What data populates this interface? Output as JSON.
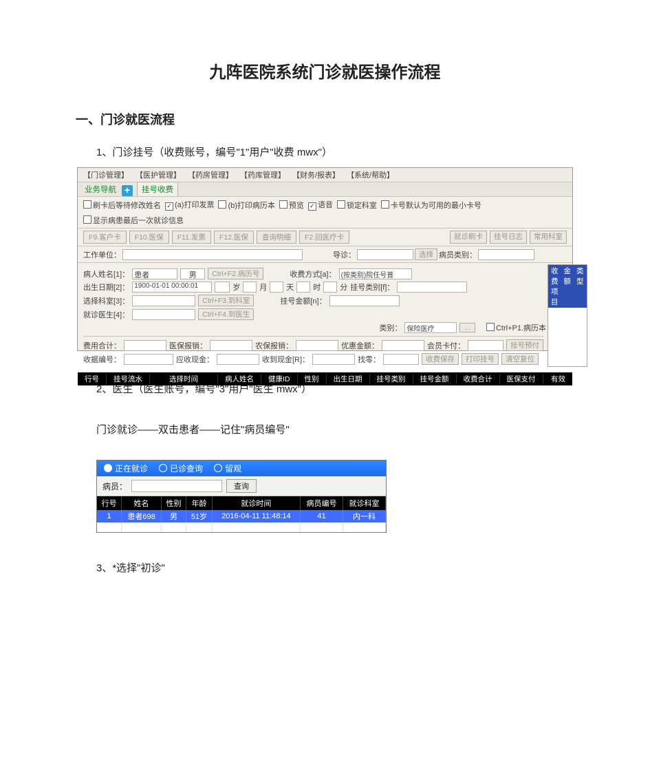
{
  "doc": {
    "title": "九阵医院系统门诊就医操作流程",
    "section1": "一、门诊就医流程",
    "step1": "1、门诊挂号（收费账号，编号\"1\"用户\"收费 mwx\"）",
    "step2": "2、医生（医生账号，编号\"3\"用户\"医生 mwx\"）",
    "step2b": "门诊就诊——双击患者——记住\"病员编号\"",
    "step3": "3、*选择\"初诊\""
  },
  "reg": {
    "menus": [
      "【门诊管理】",
      "【医护管理】",
      "【药房管理】",
      "【药库管理】",
      "【财务/报表】",
      "【系统/帮助】"
    ],
    "nav_tab": "业务导航",
    "active_tab": "挂号收费",
    "options": {
      "o1": "刷卡后等待修改姓名",
      "o2": "(a)打印发票",
      "o3": "(b)打印病历本",
      "o4": "预览",
      "o5": "语音",
      "o6": "锁定科室",
      "o7": "卡号默认为可用的最小卡号",
      "o8": "显示病患最后一次就诊信息"
    },
    "toolbar": {
      "b1": "F9.客户卡",
      "b2": "F10.医保",
      "b3": "F11.发票",
      "b4": "F12.医保",
      "b5": "查询明细",
      "b6": "F2.回医疗卡",
      "b7": "就诊刷卡",
      "b8": "挂号日志",
      "b9": "常用科室"
    },
    "work_unit": "工作单位：",
    "guide": "导诊：",
    "dept_btn": "选择",
    "patient_type": "病员类别：",
    "row1": {
      "name_lbl": "病人姓名[1]：",
      "name_val": "患者",
      "sex_val": "男",
      "hint1": "Ctrl+F2.病历号",
      "pay_lbl": "收费方式[a]：",
      "pay_val": "(按类别)院任号普"
    },
    "row2": {
      "birth_lbl": "出生日期[2]：",
      "birth_val": "1900-01-01 00:00:01",
      "age_y": "岁",
      "age_m": "月",
      "age_d": "天",
      "time_h": "时",
      "time_m": "分",
      "type_lbl": "挂号类别[f]："
    },
    "row3": {
      "dept_lbl": "选择科室[3]：",
      "hint": "Ctrl+F3.到科室",
      "amt_lbl": "挂号金额[n]："
    },
    "row4": {
      "doc_lbl": "就诊医生[4]：",
      "hint": "Ctrl+F4.到医生"
    },
    "row4b": {
      "cls_lbl": "类别：",
      "cls_val": "保险医疗",
      "cb": "Ctrl+P1.病历本"
    },
    "panel": {
      "c1": "收费项目",
      "c2": "金额",
      "c3": "类型"
    },
    "sum1": {
      "a": "费用合计：",
      "b": "医保报销：",
      "c": "农保报销：",
      "d": "优惠金额：",
      "e": "会员卡付：",
      "f": "挂号预付"
    },
    "sum2": {
      "a": "收据编号：",
      "b": "应收现金：",
      "c": "收到现金[R]：",
      "d": "找零：",
      "e": "收费保存",
      "f": "打印挂号",
      "g": "清空复位"
    },
    "cols": [
      "行号",
      "挂号流水",
      "选择时间",
      "病人姓名",
      "健康ID",
      "性别",
      "出生日期",
      "挂号类别",
      "挂号金额",
      "收费合计",
      "医保支付",
      "有效"
    ]
  },
  "patients": {
    "tabs": {
      "t1": "正在就诊",
      "t2": "已诊查询",
      "t3": "留观"
    },
    "query_lbl": "病员：",
    "query_btn": "查询",
    "headers": [
      "行号",
      "姓名",
      "性别",
      "年龄",
      "就诊时间",
      "病员编号",
      "就诊科室"
    ],
    "rows": [
      {
        "no": "1",
        "name": "患者698",
        "sex": "男",
        "age": "51岁",
        "time": "2016-04-11 11:48:14",
        "pid": "41",
        "dept": "内一科"
      },
      {
        "no": "",
        "name": "",
        "sex": "",
        "age": "",
        "time": "",
        "pid": "",
        "dept": ""
      }
    ]
  }
}
